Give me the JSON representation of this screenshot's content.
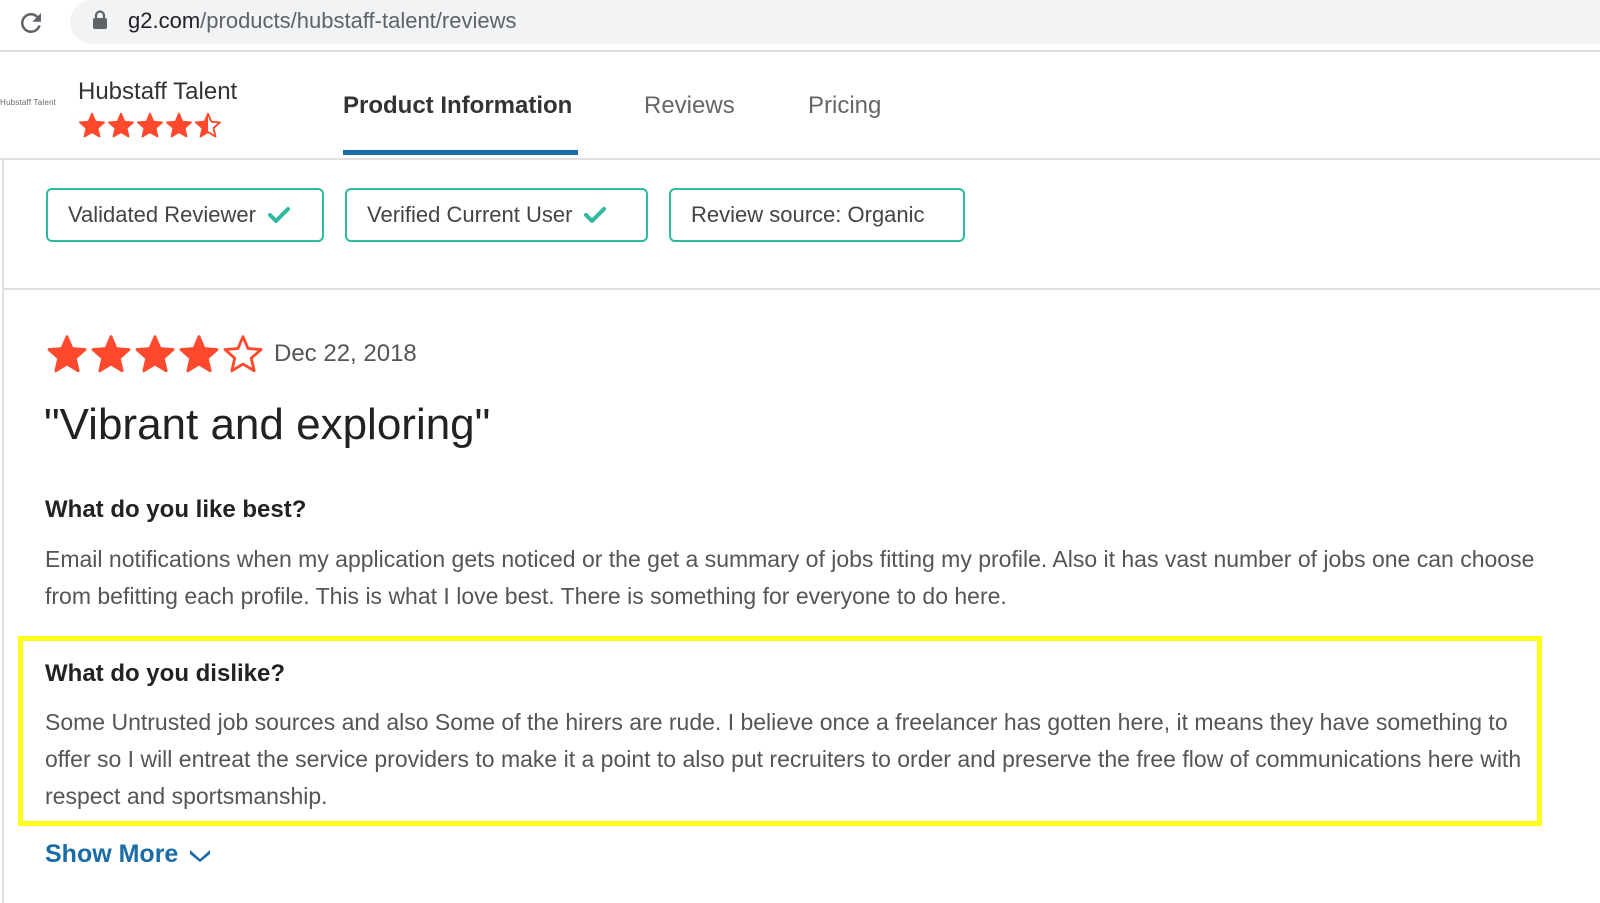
{
  "browser": {
    "url_domain": "g2.com",
    "url_path": "/products/hubstaff-talent/reviews",
    "icons": [
      "reload-icon",
      "lock-icon"
    ]
  },
  "product": {
    "logo_text": "Hubstaff Talent",
    "name": "Hubstaff Talent",
    "rating": 4.5,
    "rating_max": 5,
    "star_color": "#ff492c"
  },
  "nav": {
    "tabs": [
      {
        "label": "Product Information",
        "active": true
      },
      {
        "label": "Reviews",
        "active": false
      },
      {
        "label": "Pricing",
        "active": false
      }
    ],
    "active_color": "#1a6ca6"
  },
  "badges": [
    {
      "label": "Validated Reviewer",
      "icon": "check-icon"
    },
    {
      "label": "Verified Current User",
      "icon": "check-icon"
    },
    {
      "label": "Review source: Organic",
      "icon": ""
    }
  ],
  "review": {
    "rating": 4,
    "rating_max": 5,
    "date": "Dec 22, 2018",
    "title": "\"Vibrant and exploring\"",
    "like_question": "What do you like best?",
    "like_answer": "Email notifications when my application gets noticed or the get a summary of jobs fitting my profile. Also it has vast number of jobs one can choose from befitting each profile. This is what I love best. There is something for everyone to do here.",
    "dislike_question": "What do you dislike?",
    "dislike_answer": "Some Untrusted job sources and also Some of the hirers are rude. I believe once a freelancer has gotten here, it means they have something to offer so I will entreat the service providers to make it a point to also put recruiters to order and preserve the free flow of communications here with respect and sportsmanship.",
    "show_more": "Show More"
  },
  "colors": {
    "badge_border": "#2dbb9f",
    "highlight": "#ffff1a",
    "link": "#1a6ca6"
  }
}
